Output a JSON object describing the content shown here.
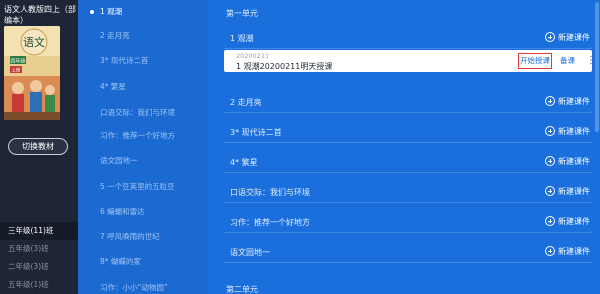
{
  "book": {
    "title": "语文人教版四上（部编本）",
    "cover_title": "语文",
    "cover_subtitle": "四年级",
    "cover_volume": "上册",
    "switch_label": "切换教材"
  },
  "classes": [
    {
      "label": "三年级(11)班",
      "active": true
    },
    {
      "label": "五年级(3)班",
      "active": false
    },
    {
      "label": "二年级(3)班",
      "active": false
    },
    {
      "label": "五年级(1)班",
      "active": false
    }
  ],
  "nav": [
    {
      "label": "1 观潮",
      "active": true
    },
    {
      "label": "2 走月亮",
      "active": false
    },
    {
      "label": "3* 现代诗二首",
      "active": false
    },
    {
      "label": "4* 繁星",
      "active": false
    },
    {
      "label": "口语交际：我们与环境",
      "active": false
    },
    {
      "label": "习作：推荐一个好地方",
      "active": false
    },
    {
      "label": "语文园地一",
      "active": false
    },
    {
      "label": "5 一个豆荚里的五粒豆",
      "active": false
    },
    {
      "label": "6 蝙蝠和雷达",
      "active": false
    },
    {
      "label": "7 呼风唤雨的世纪",
      "active": false
    },
    {
      "label": "8* 蝴蝶的家",
      "active": false
    },
    {
      "label": "习作：小小“动物园”",
      "active": false
    }
  ],
  "content": {
    "unit1_title": "第一单元",
    "unit2_title": "第二单元",
    "new_courseware_label": "新建课件",
    "lesson": {
      "date": "20200211",
      "name": "1 观潮20200211明天授课",
      "start_label": "开始授课",
      "prep_label": "备课"
    },
    "rows": [
      "1 观潮",
      "2 走月亮",
      "3* 现代诗二首",
      "4* 繁星",
      "口语交际：我们与环境",
      "习作：推荐一个好地方",
      "语文园地一"
    ]
  }
}
